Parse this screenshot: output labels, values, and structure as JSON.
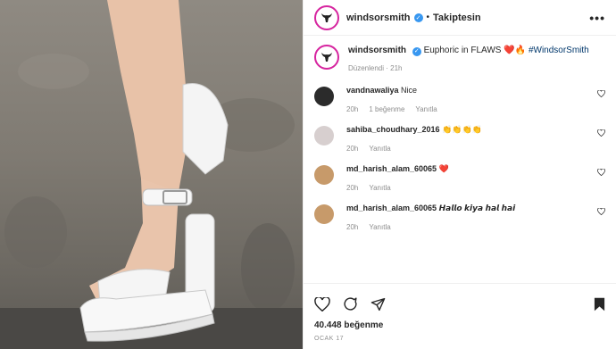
{
  "header": {
    "username": "windsorsmith",
    "follow_status": "Takiptesin",
    "separator": "•",
    "more": "•••"
  },
  "caption": {
    "username": "windsorsmith",
    "text": "Euphoric in FLAWS",
    "emojis": "❤️🔥",
    "hashtag": "#WindsorSmith",
    "edited": "Düzenlendi",
    "time": "21h"
  },
  "comments": [
    {
      "username": "vandnawaliya",
      "text": "Nice",
      "time": "20h",
      "likes": "1 beğenme",
      "reply": "Yanıtla",
      "avatar_color": "#2b2b2b"
    },
    {
      "username": "sahiba_choudhary_2016",
      "text": "👏👏👏👏",
      "time": "20h",
      "likes": "",
      "reply": "Yanıtla",
      "avatar_color": "#d7cfcf"
    },
    {
      "username": "md_harish_alam_60065",
      "text": "❤️",
      "time": "20h",
      "likes": "",
      "reply": "Yanıtla",
      "avatar_color": "#c79a6a"
    },
    {
      "username": "md_harish_alam_60065",
      "text": "𝙃𝙖𝙡𝙡𝙤 𝙠𝙞𝙮𝙖 𝙝𝙖𝙡 𝙝𝙖𝙞",
      "time": "20h",
      "likes": "",
      "reply": "Yanıtla",
      "avatar_color": "#c79a6a"
    }
  ],
  "footer": {
    "likes": "40.448 beğenme",
    "date": "OCAK 17"
  },
  "colors": {
    "accent": "#3897f0",
    "like_red": "#e0245e",
    "muted": "#8e8e8e"
  }
}
